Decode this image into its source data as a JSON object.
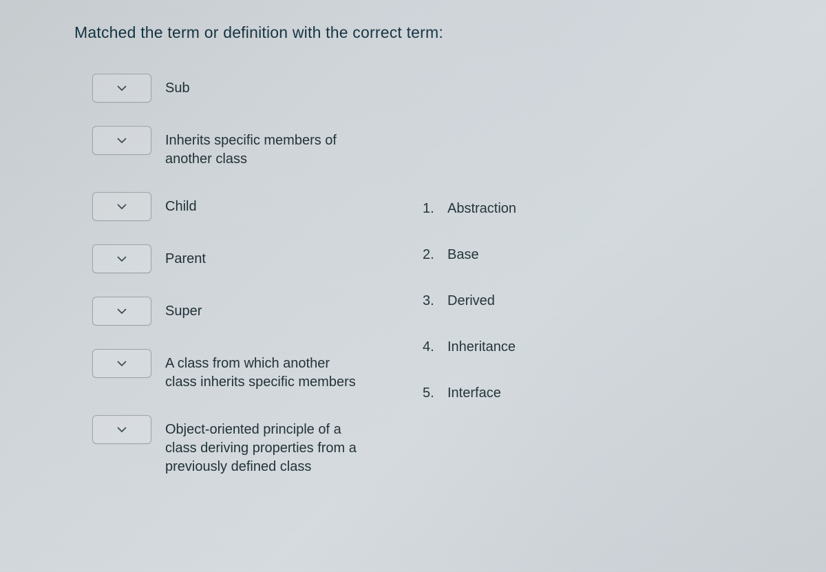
{
  "prompt": "Matched the term or definition with the correct term:",
  "match_items": [
    {
      "label": "Sub"
    },
    {
      "label": "Inherits specific members of another class"
    },
    {
      "label": "Child"
    },
    {
      "label": "Parent"
    },
    {
      "label": "Super"
    },
    {
      "label": "A class from which another class inherits specific members"
    },
    {
      "label": "Object-oriented principle of a class deriving properties from a previously defined class"
    }
  ],
  "answers": [
    {
      "num": "1.",
      "text": "Abstraction"
    },
    {
      "num": "2.",
      "text": "Base"
    },
    {
      "num": "3.",
      "text": "Derived"
    },
    {
      "num": "4.",
      "text": "Inheritance"
    },
    {
      "num": "5.",
      "text": "Interface"
    }
  ]
}
